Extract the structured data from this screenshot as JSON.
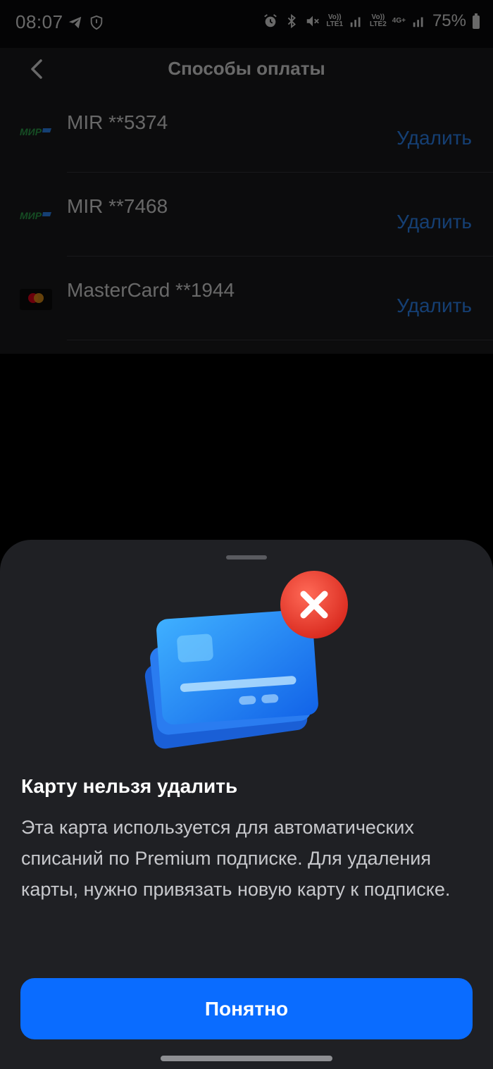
{
  "status_bar": {
    "time": "08:07",
    "left_icons": [
      "telegram-icon",
      "shield-icon"
    ],
    "right_icons": [
      "alarm-icon",
      "bluetooth-icon",
      "mute-icon",
      "volte-lte1-icon",
      "signal-icon",
      "volte-lte2-icon",
      "4g-plus-icon",
      "signal-icon",
      "battery-icon"
    ],
    "lte1_label": "Vo))\nLTE1",
    "lte2_label": "Vo))\nLTE2",
    "net_label": "4G+",
    "battery": "75%"
  },
  "header": {
    "back_icon": "chevron-left-icon",
    "title": "Способы оплаты"
  },
  "cards": [
    {
      "logo": "mir-logo",
      "name": "MIR **5374",
      "action": "Удалить"
    },
    {
      "logo": "mir-logo",
      "name": "MIR **7468",
      "action": "Удалить"
    },
    {
      "logo": "mastercard-logo",
      "name": "MasterCard **1944",
      "action": "Удалить"
    }
  ],
  "sheet": {
    "illustration": "card-delete-error-icon",
    "title": "Карту нельзя удалить",
    "text": "Эта карта используется для автоматических списаний по Premium подписке. Для удаления карты, нужно привязать новую карту к подписке.",
    "button": "Понятно"
  },
  "colors": {
    "accent": "#0a6cff",
    "link": "#2f8cff",
    "sheet_bg": "#1f2024",
    "error_red": "#e8392c"
  }
}
